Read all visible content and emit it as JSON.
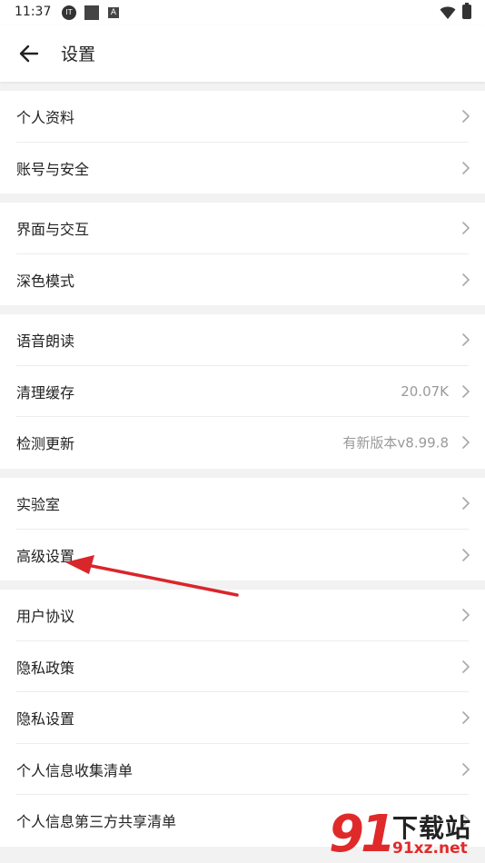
{
  "status_bar": {
    "time": "11:37",
    "icons": [
      "notification-circle-icon",
      "square-app-icon",
      "a-box-icon",
      "wifi-icon",
      "battery-icon"
    ]
  },
  "app_bar": {
    "back_icon": "arrow-left-icon",
    "title": "设置"
  },
  "groups": [
    {
      "items": [
        {
          "label": "个人资料"
        },
        {
          "label": "账号与安全"
        }
      ]
    },
    {
      "items": [
        {
          "label": "界面与交互"
        },
        {
          "label": "深色模式"
        }
      ]
    },
    {
      "items": [
        {
          "label": "语音朗读"
        },
        {
          "label": "清理缓存",
          "value": "20.07K"
        },
        {
          "label": "检测更新",
          "value": "有新版本v8.99.8"
        }
      ]
    },
    {
      "items": [
        {
          "label": "实验室"
        },
        {
          "label": "高级设置"
        }
      ]
    },
    {
      "items": [
        {
          "label": "用户协议"
        },
        {
          "label": "隐私政策"
        },
        {
          "label": "隐私设置"
        },
        {
          "label": "个人信息收集清单"
        },
        {
          "label": "个人信息第三方共享清单"
        }
      ]
    }
  ],
  "annotation": {
    "color": "#d9262b",
    "points_to": "高级设置"
  },
  "watermark": {
    "number": "91",
    "text": "下载站",
    "url": "91xz.net"
  },
  "colors": {
    "background": "#f2f2f2",
    "surface": "#ffffff",
    "secondary_text": "#9a9a9a",
    "accent_red": "#e02a2a"
  }
}
